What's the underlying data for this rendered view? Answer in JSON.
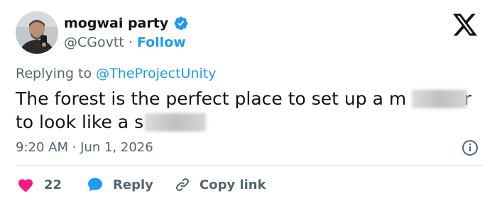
{
  "author": {
    "display_name": "mogwai party",
    "handle": "@CGovtt",
    "separator": "·",
    "follow_label": "Follow",
    "verified_icon": "verified-badge-icon",
    "avatar_icon": "profile-avatar"
  },
  "brand": {
    "logo_icon": "x-logo-icon",
    "accent": "#1d9bf0"
  },
  "reply_context": {
    "prefix": "Replying to",
    "mention": "@TheProjectUnity"
  },
  "tweet": {
    "line1_visible": "The forest is the perfect place to set up a m",
    "line1_tail": "er",
    "line2_visible": "to look like a s",
    "line2_tail": "e."
  },
  "meta": {
    "timestamp": "9:20 AM · Jun 1, 2026",
    "info_icon": "info-icon"
  },
  "actions": {
    "like_count": "22",
    "like_icon": "heart-icon",
    "like_color": "#f91880",
    "reply_label": "Reply",
    "reply_icon": "speech-bubble-icon",
    "copy_label": "Copy link",
    "copy_icon": "link-icon"
  }
}
